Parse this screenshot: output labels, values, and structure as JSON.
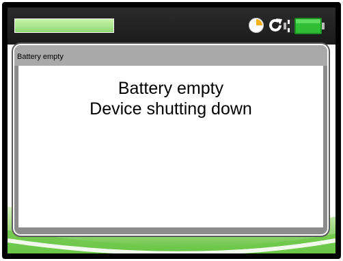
{
  "status_bar": {
    "field_text": "",
    "icons": [
      "clock-icon",
      "refresh-icon",
      "battery-icon"
    ]
  },
  "dialog": {
    "title": "Battery empty",
    "message_line1": "Battery empty",
    "message_line2": "Device shutting down"
  },
  "colors": {
    "accent_green": "#8fd66f",
    "frame": "#000000",
    "dialog_border": "#8c8c8c"
  }
}
